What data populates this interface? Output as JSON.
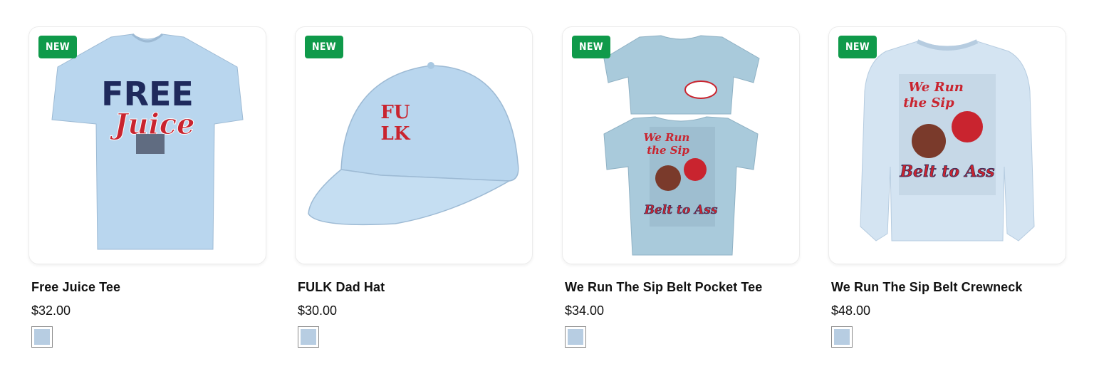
{
  "colors": {
    "badge_bg": "#0f9a4a",
    "swatch_color": "#b7cde2",
    "product_blue": "#b9d6ee"
  },
  "products": [
    {
      "badge": "NEW",
      "title": "Free Juice Tee",
      "price": "$32.00",
      "image_text": [
        "FREE",
        "Juice"
      ],
      "swatch": "light-blue"
    },
    {
      "badge": "NEW",
      "title": "FULK Dad Hat",
      "price": "$30.00",
      "image_text": [
        "FU",
        "LK"
      ],
      "swatch": "light-blue"
    },
    {
      "badge": "NEW",
      "title": "We Run The Sip Belt Pocket Tee",
      "price": "$34.00",
      "image_text": [
        "We Run",
        "the Sip",
        "Belt to Ass"
      ],
      "swatch": "light-blue"
    },
    {
      "badge": "NEW",
      "title": "We Run The Sip Belt Crewneck",
      "price": "$48.00",
      "image_text": [
        "We Run",
        "the Sip",
        "Belt to Ass"
      ],
      "swatch": "light-blue"
    }
  ]
}
